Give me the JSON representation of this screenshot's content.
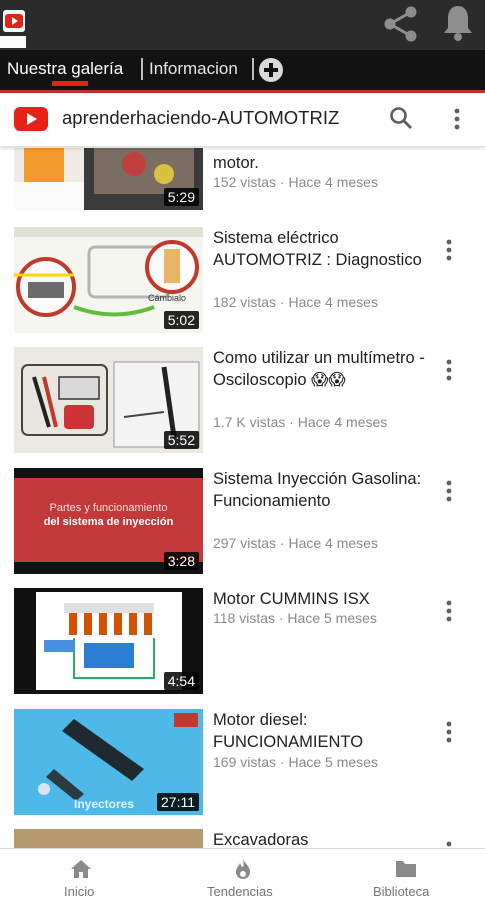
{
  "colors": {
    "accent": "#e62117",
    "tab_bar": "#121212",
    "app_bar": "#2b2b2b"
  },
  "appbar": {
    "icons": [
      "app-logo-icon",
      "share-icon",
      "bell-icon"
    ]
  },
  "tabs": [
    {
      "label": "Nuestra galería"
    },
    {
      "label": "Informacion"
    }
  ],
  "add_tab_icon": "add-circle-icon",
  "channel": {
    "title": "aprenderhaciendo-AUTOMOTRIZ"
  },
  "videos": [
    {
      "title": "motor.",
      "meta": "152 vistas · Hace 4 meses",
      "duration": "5:29"
    },
    {
      "title": "Sistema eléctrico AUTOMOTRIZ : Diagnostico",
      "meta": "182 vistas · Hace 4 meses",
      "duration": "5:02",
      "thumb_text": "Cámbialo"
    },
    {
      "title": "Como utilizar un multímetro - Osciloscopio 😱😱",
      "meta": "1.7 K vistas · Hace 4 meses",
      "duration": "5:52"
    },
    {
      "title": "Sistema Inyección Gasolina: Funcionamiento",
      "meta": "297 vistas · Hace 4 meses",
      "duration": "3:28",
      "thumb_line1": "Partes y funcionamiento",
      "thumb_line2": "del sistema de inyección"
    },
    {
      "title": "Motor CUMMINS ISX",
      "meta": "118 vistas · Hace 5 meses",
      "duration": "4:54"
    },
    {
      "title": "Motor diesel: FUNCIONAMIENTO",
      "meta": "169 vistas · Hace 5 meses",
      "duration": "27:11",
      "thumb_text": "Inyectores"
    },
    {
      "title": "Excavadoras"
    }
  ],
  "bottom_nav": [
    {
      "label": "Inicio",
      "icon": "home-icon"
    },
    {
      "label": "Tendencias",
      "icon": "flame-icon"
    },
    {
      "label": "Biblioteca",
      "icon": "folder-icon"
    }
  ]
}
